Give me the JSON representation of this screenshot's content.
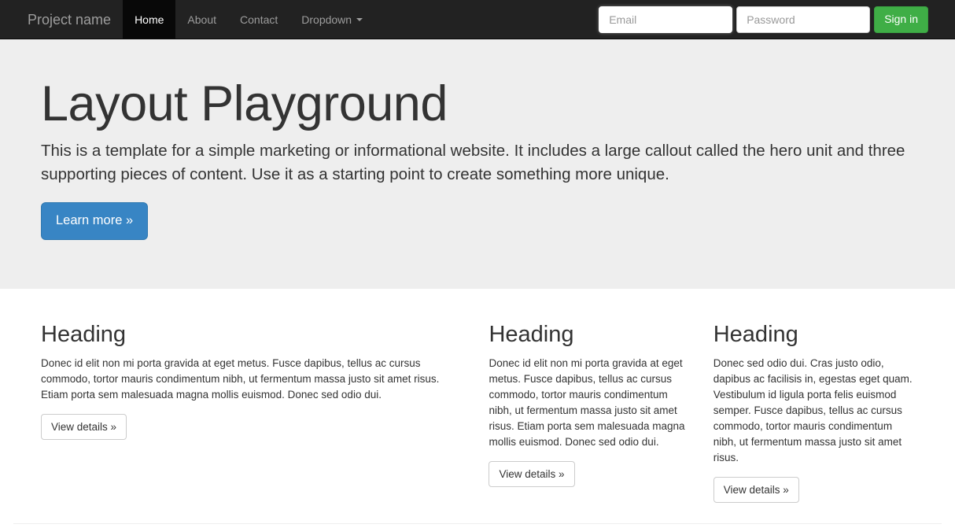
{
  "navbar": {
    "brand": "Project name",
    "items": [
      {
        "label": "Home",
        "active": true
      },
      {
        "label": "About",
        "active": false
      },
      {
        "label": "Contact",
        "active": false
      },
      {
        "label": "Dropdown",
        "active": false,
        "caret": "caret-down-icon"
      }
    ],
    "form": {
      "email_value": "",
      "email_placeholder": "Email",
      "password_value": "",
      "password_placeholder": "Password",
      "signin_label": "Sign in"
    },
    "colors": {
      "background": "#222222",
      "link": "#9d9d9d",
      "active_background": "#080808",
      "signin_background": "#3fae46"
    }
  },
  "hero": {
    "title": "Layout Playground",
    "paragraph": "This is a template for a simple marketing or informational website. It includes a large callout called the hero unit and three supporting pieces of content. Use it as a starting point to create something more unique.",
    "cta_label": "Learn more »",
    "background": "#eeeeee",
    "cta_background": "#3885c4"
  },
  "columns": [
    {
      "heading": "Heading",
      "body": "Donec id elit non mi porta gravida at eget metus. Fusce dapibus, tellus ac cursus commodo, tortor mauris condimentum nibh, ut fermentum massa justo sit amet risus. Etiam porta sem malesuada magna mollis euismod. Donec sed odio dui.",
      "button_label": "View details »"
    },
    {
      "heading": "Heading",
      "body": "Donec id elit non mi porta gravida at eget metus. Fusce dapibus, tellus ac cursus commodo, tortor mauris condimentum nibh, ut fermentum massa justo sit amet risus. Etiam porta sem malesuada magna mollis euismod. Donec sed odio dui.",
      "button_label": "View details »"
    },
    {
      "heading": "Heading",
      "body": "Donec sed odio dui. Cras justo odio, dapibus ac facilisis in, egestas eget quam. Vestibulum id ligula porta felis euismod semper. Fusce dapibus, tellus ac cursus commodo, tortor mauris condimentum nibh, ut fermentum massa justo sit amet risus.",
      "button_label": "View details »"
    }
  ]
}
